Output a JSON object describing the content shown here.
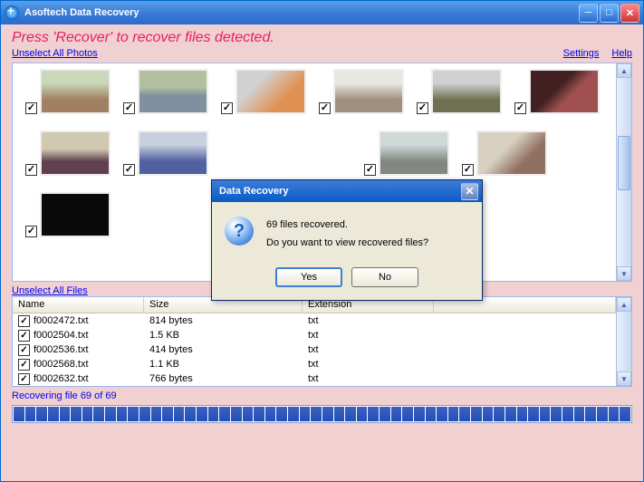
{
  "window": {
    "title": "Asoftech Data Recovery"
  },
  "instruction": "Press 'Recover' to recover files detected.",
  "links": {
    "unselect_photos": "Unselect All Photos",
    "unselect_files": "Unselect All Files",
    "settings": "Settings",
    "help": "Help"
  },
  "files_table": {
    "headers": {
      "name": "Name",
      "size": "Size",
      "ext": "Extension"
    },
    "rows": [
      {
        "name": "f0002472.txt",
        "size": "814 bytes",
        "ext": "txt"
      },
      {
        "name": "f0002504.txt",
        "size": "1.5 KB",
        "ext": "txt"
      },
      {
        "name": "f0002536.txt",
        "size": "414 bytes",
        "ext": "txt"
      },
      {
        "name": "f0002568.txt",
        "size": "1.1 KB",
        "ext": "txt"
      },
      {
        "name": "f0002632.txt",
        "size": "766 bytes",
        "ext": "txt"
      }
    ]
  },
  "status": "Recovering file 69 of 69",
  "dialog": {
    "title": "Data Recovery",
    "line1": "69 files recovered.",
    "line2": "Do you want to view recovered files?",
    "yes": "Yes",
    "no": "No"
  }
}
